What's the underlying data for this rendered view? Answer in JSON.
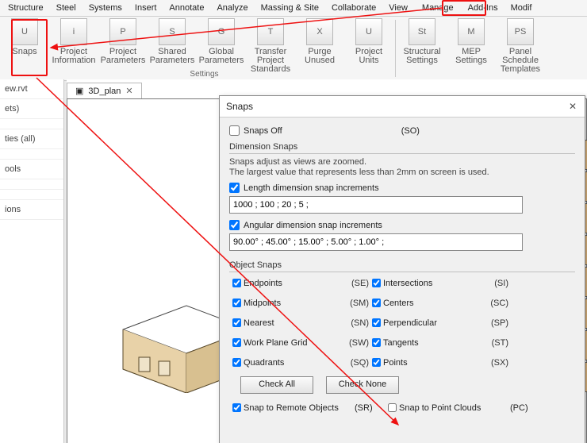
{
  "menubar": [
    "Structure",
    "Steel",
    "Systems",
    "Insert",
    "Annotate",
    "Analyze",
    "Massing & Site",
    "Collaborate",
    "View",
    "Manage",
    "Add-Ins",
    "Modif"
  ],
  "ribbon": {
    "buttons": [
      {
        "label": "Snaps",
        "icon": "U"
      },
      {
        "label": "Project\nInformation",
        "icon": "i"
      },
      {
        "label": "Project\nParameters",
        "icon": "P"
      },
      {
        "label": "Shared\nParameters",
        "icon": "S"
      },
      {
        "label": "Global\nParameters",
        "icon": "G"
      },
      {
        "label": "Transfer\nProject Standards",
        "icon": "T"
      },
      {
        "label": "Purge\nUnused",
        "icon": "X"
      },
      {
        "label": "Project\nUnits",
        "icon": "U"
      },
      {
        "label": "Structural\nSettings",
        "icon": "St"
      },
      {
        "label": "MEP\nSettings",
        "icon": "M"
      },
      {
        "label": "Panel Schedule\nTemplates",
        "icon": "PS"
      }
    ],
    "panel_label": "Settings"
  },
  "leftcol": {
    "items": [
      "ew.rvt",
      "ets)",
      "",
      "ties (all)",
      "",
      "ools",
      "",
      "",
      "ions"
    ]
  },
  "tabs": {
    "active": "3D_plan",
    "close": "✕"
  },
  "dialog": {
    "title": "Snaps",
    "snaps_off": {
      "label": "Snaps Off",
      "code": "(SO)",
      "checked": false
    },
    "dim_title": "Dimension Snaps",
    "help1": "Snaps adjust as views are zoomed.",
    "help2": "The largest value that represents less than 2mm on screen is used.",
    "length_cb": {
      "label": "Length dimension snap increments",
      "checked": true
    },
    "length_val": "1000 ; 100 ; 20 ; 5 ;",
    "ang_cb": {
      "label": "Angular dimension snap increments",
      "checked": true
    },
    "ang_val": "90.00° ; 45.00° ; 15.00° ; 5.00° ; 1.00° ;",
    "obj_title": "Object Snaps",
    "snaps": [
      {
        "label": "Endpoints",
        "code": "(SE)",
        "checked": true
      },
      {
        "label": "Intersections",
        "code": "(SI)",
        "checked": true
      },
      {
        "label": "Midpoints",
        "code": "(SM)",
        "checked": true
      },
      {
        "label": "Centers",
        "code": "(SC)",
        "checked": true
      },
      {
        "label": "Nearest",
        "code": "(SN)",
        "checked": true
      },
      {
        "label": "Perpendicular",
        "code": "(SP)",
        "checked": true
      },
      {
        "label": "Work Plane Grid",
        "code": "(SW)",
        "checked": true
      },
      {
        "label": "Tangents",
        "code": "(ST)",
        "checked": true
      },
      {
        "label": "Quadrants",
        "code": "(SQ)",
        "checked": true
      },
      {
        "label": "Points",
        "code": "(SX)",
        "checked": true
      }
    ],
    "check_all": "Check All",
    "check_none": "Check None",
    "remote": {
      "label": "Snap to Remote Objects",
      "code": "(SR)",
      "checked": true
    },
    "pcloud": {
      "label": "Snap to Point Clouds",
      "code": "(PC)",
      "checked": false
    }
  }
}
